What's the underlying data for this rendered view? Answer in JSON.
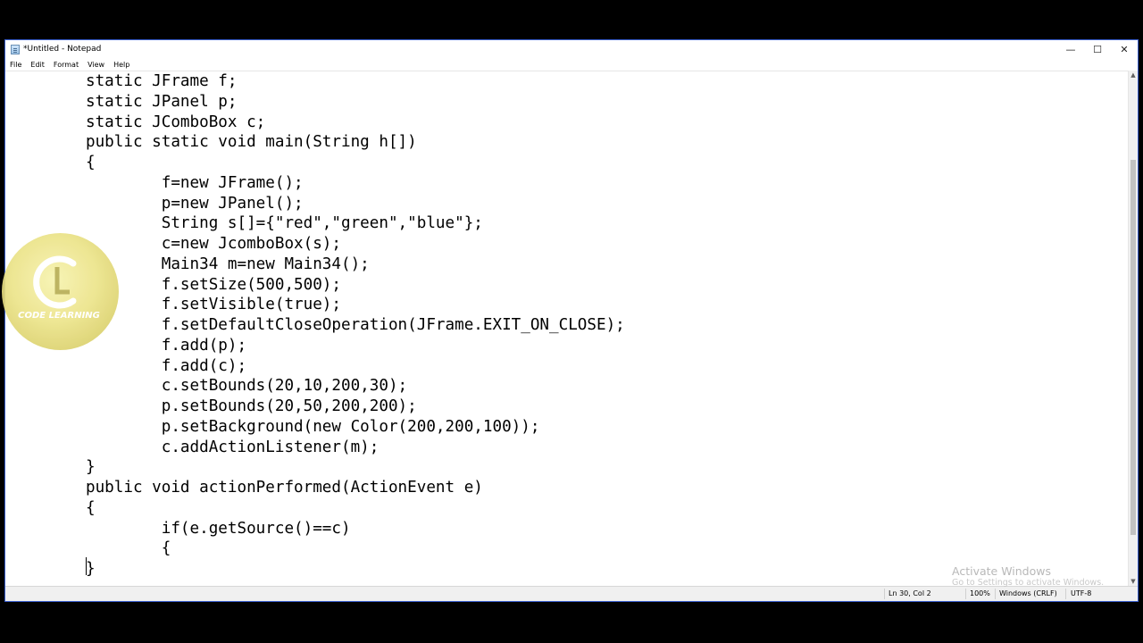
{
  "window": {
    "title": "*Untitled - Notepad"
  },
  "menu": [
    "File",
    "Edit",
    "Format",
    "View",
    "Help"
  ],
  "controls": {
    "minimize": "—",
    "maximize": "☐",
    "close": "✕"
  },
  "code": [
    "static JFrame f;",
    "static JPanel p;",
    "static JComboBox c;",
    "public static void main(String h[])",
    "{",
    "        f=new JFrame();",
    "        p=new JPanel();",
    "        String s[]={\"red\",\"green\",\"blue\"};",
    "        c=new JcomboBox(s);",
    "        Main34 m=new Main34();",
    "        f.setSize(500,500);",
    "        f.setVisible(true);",
    "        f.setDefaultCloseOperation(JFrame.EXIT_ON_CLOSE);",
    "        f.add(p);",
    "        f.add(c);",
    "        c.setBounds(20,10,200,30);",
    "        p.setBounds(20,50,200,200);",
    "        p.setBackground(new Color(200,200,100));",
    "        c.addActionListener(m);",
    "}",
    "public void actionPerformed(ActionEvent e)",
    "{",
    "        if(e.getSource()==c)",
    "        {",
    "}"
  ],
  "status": {
    "position": "Ln 30, Col 2",
    "zoom": "100%",
    "line_ending": "Windows (CRLF)",
    "encoding": "UTF-8"
  },
  "watermark": {
    "title": "Activate Windows",
    "subtitle": "Go to Settings to activate Windows."
  },
  "logo": {
    "text": "CODE LEARNING"
  },
  "colors": {
    "accent_border": "#3a5fcd",
    "logo_fill": "#ece48a"
  }
}
